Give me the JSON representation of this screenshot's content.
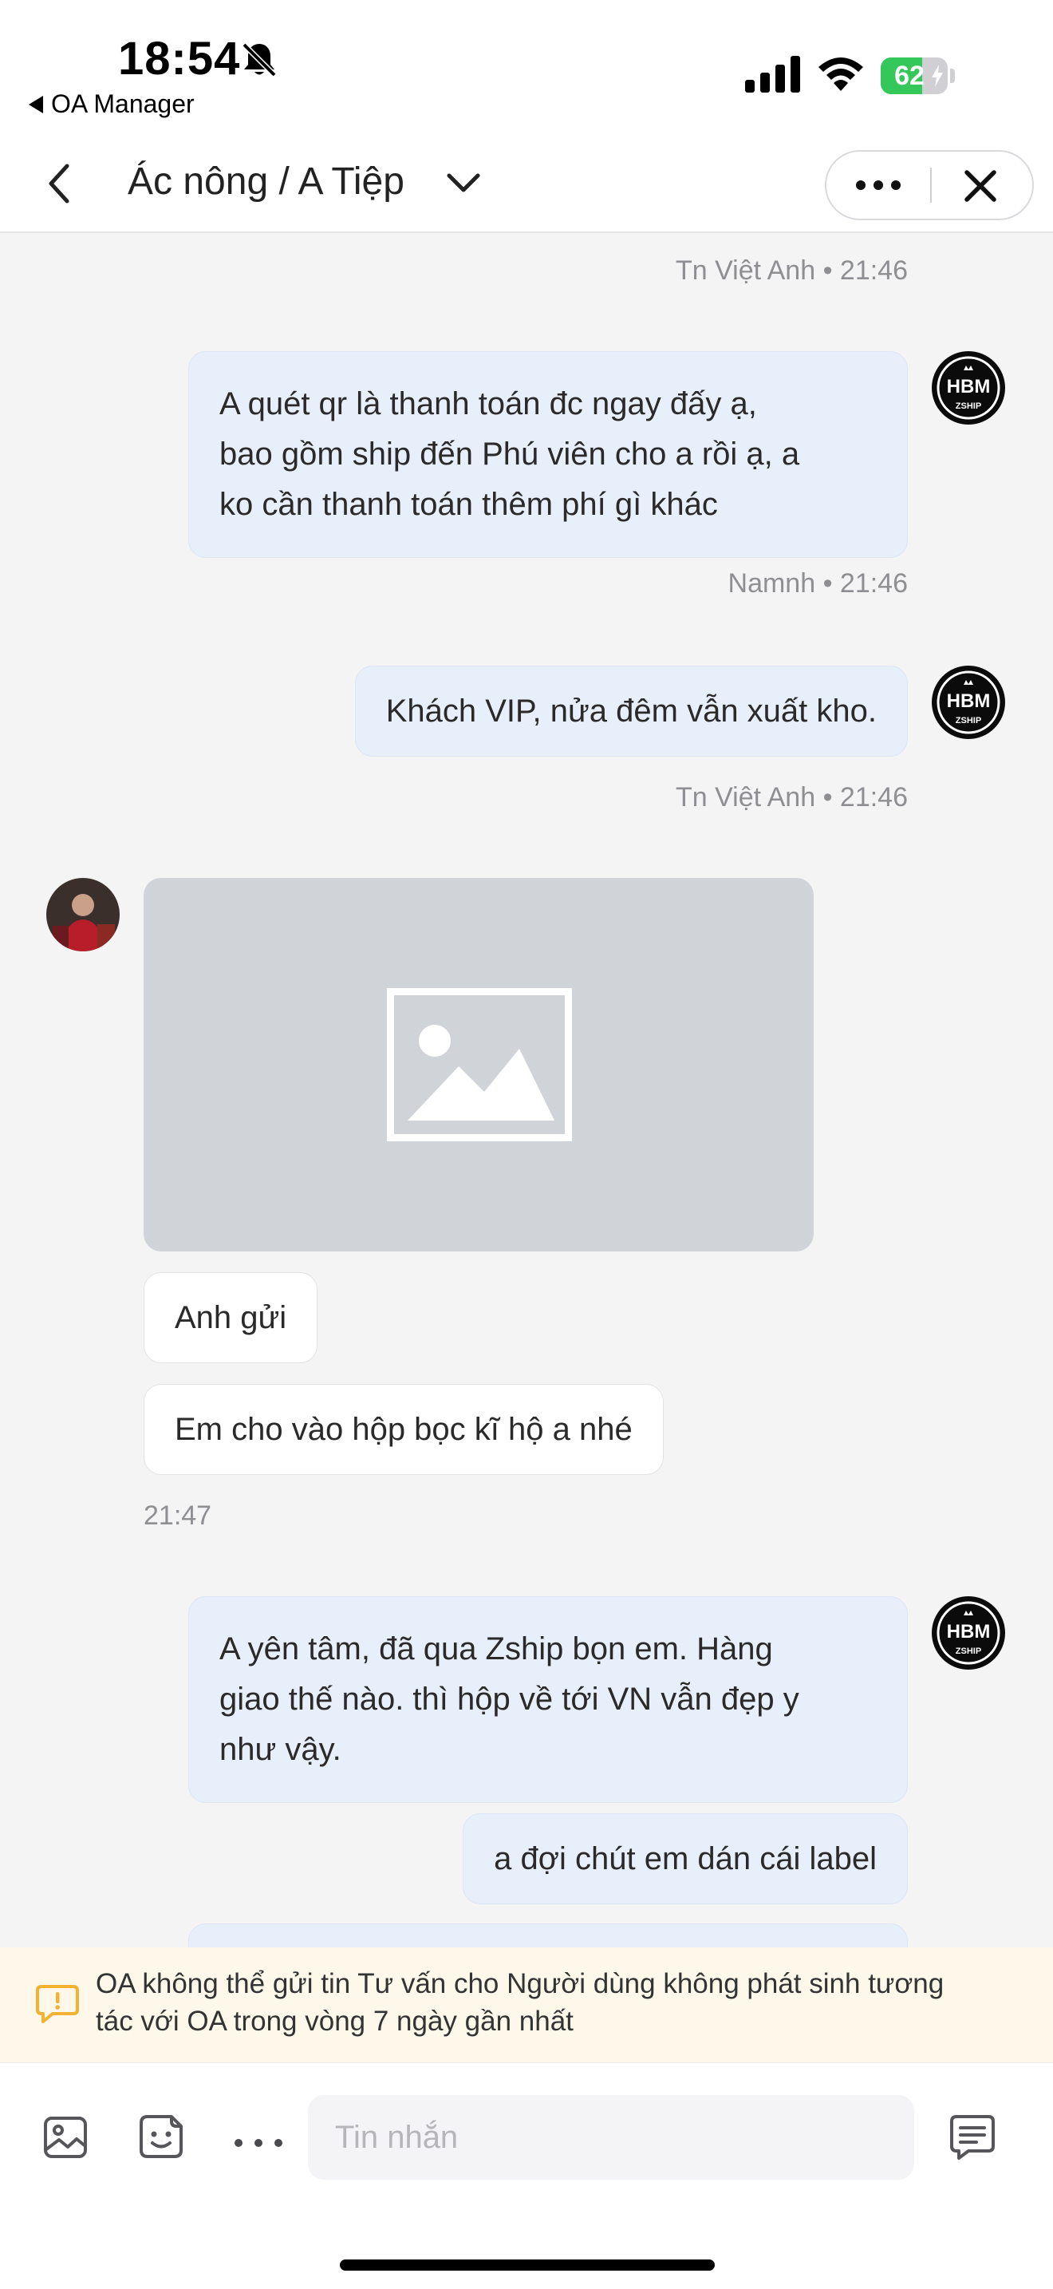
{
  "status_bar": {
    "time": "18:54",
    "back_app": "OA Manager",
    "battery_percent": "62",
    "battery_level": 0.62,
    "icons": [
      "bell-slash-icon",
      "signal-icon",
      "wifi-icon",
      "battery-charging-icon"
    ]
  },
  "header": {
    "title": "Ác nông / A Tiệp",
    "icons": [
      "back-chevron-icon",
      "chevron-down-icon",
      "more-dots-icon",
      "close-icon"
    ]
  },
  "messages": [
    {
      "meta": "Tn Việt Anh • 21:46"
    },
    {
      "lines": [
        "A quét qr là thanh toán đc ngay đấy ạ,",
        "bao gồm ship đến Phú viên cho a rồi ạ, a",
        "ko cần thanh toán thêm phí gì khác"
      ],
      "meta": "Namnh • 21:46"
    },
    {
      "text": "Khách VIP, nửa đêm vẫn xuất kho.",
      "meta": "Tn Việt Anh • 21:46"
    },
    {
      "text": "Anh gửi"
    },
    {
      "text": "Em cho vào hộp bọc kĩ hộ a nhé",
      "time": "21:47"
    },
    {
      "lines": [
        "A yên tâm, đã qua Zship bọn em. Hàng",
        "giao thế nào. thì hộp về tới VN vẫn đẹp y",
        "như vậy."
      ]
    },
    {
      "text": "a đợi chút em dán cái label"
    }
  ],
  "oa_avatar": {
    "letters": "HBM",
    "brand": "ZSHIP"
  },
  "warning": {
    "line1": "OA không thể gửi tin Tư vấn cho Người dùng không phát sinh tương",
    "line2": "tác với OA trong vòng 7 ngày gần nhất",
    "color": "#f2b232"
  },
  "composer": {
    "placeholder": "Tin nhắn",
    "icons": [
      "image-icon",
      "sticker-icon",
      "more-dots-icon",
      "quick-reply-icon"
    ]
  },
  "colors": {
    "outgoing_bubble": "#e7effb",
    "incoming_bubble": "#ffffff",
    "chat_background": "#f4f4f5",
    "warning_background": "#fdf8e9"
  }
}
